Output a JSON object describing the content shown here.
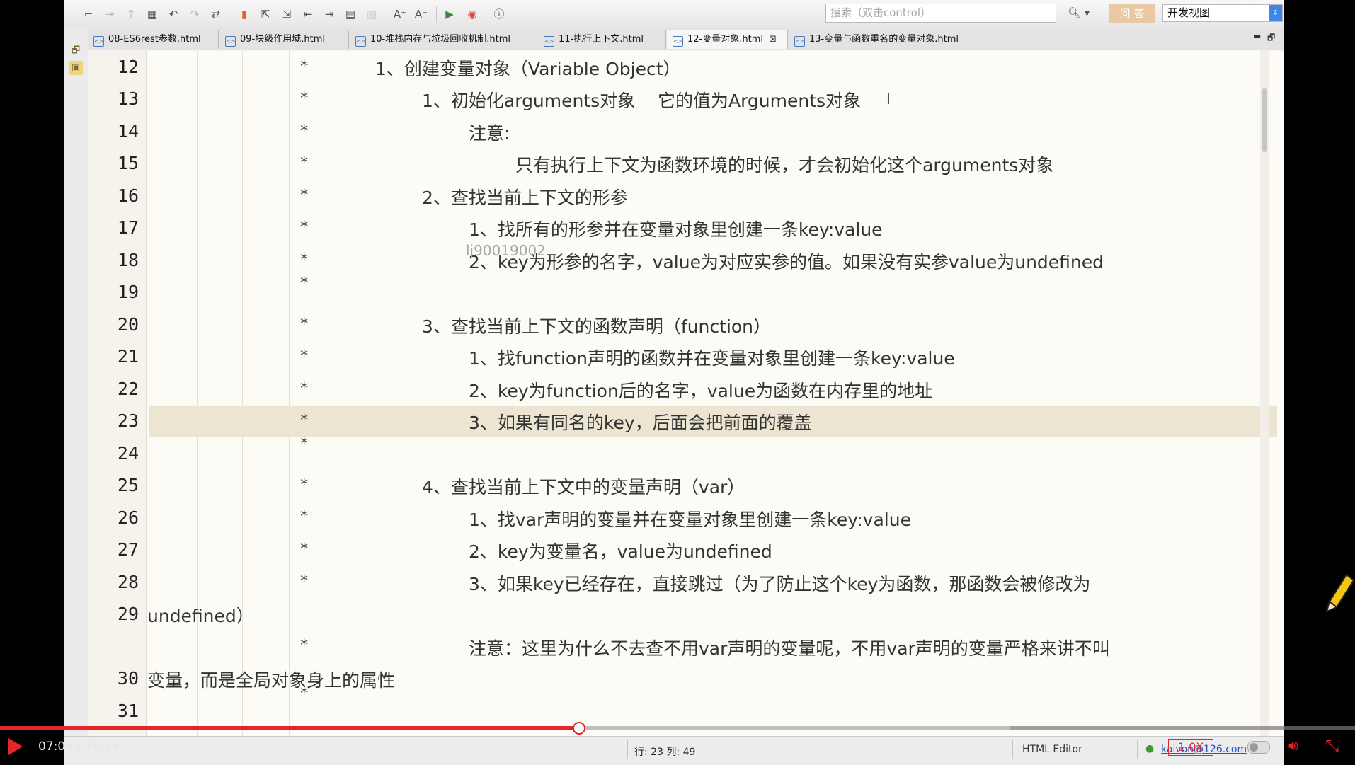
{
  "toolbar": {
    "search_placeholder": "搜索（双击control）",
    "ask_label": "问 答",
    "view_label": "开发视图"
  },
  "tabs": [
    {
      "label": "08-ES6rest参数.html"
    },
    {
      "label": "09-块级作用域.html"
    },
    {
      "label": "10-堆栈内存与垃圾回收机制.html"
    },
    {
      "label": "11-执行上下文.html"
    },
    {
      "label": "12-变量对象.html",
      "active": true
    },
    {
      "label": "13-变量与函数重名的变量对象.html"
    }
  ],
  "editor": {
    "line_numbers": [
      "12",
      "13",
      "14",
      "15",
      "16",
      "17",
      "18",
      "19",
      "20",
      "21",
      "22",
      "23",
      "24",
      "25",
      "26",
      "27",
      "28",
      "29",
      "30",
      "31"
    ],
    "lines": [
      "1、创建变量对象（Variable Object）",
      "1、初始化arguments对象    它的值为Arguments对象",
      "注意:",
      "只有执行上下文为函数环境的时候，才会初始化这个arguments对象",
      "2、查找当前上下文的形参",
      "1、找所有的形参并在变量对象里创建一条key:value",
      "2、key为形参的名字，value为对应实参的值。如果没有实参value为undefined",
      "3、查找当前上下文的函数声明（function）",
      "1、找function声明的函数并在变量对象里创建一条key:value",
      "2、key为function后的名字，value为函数在内存里的地址",
      "3、如果有同名的key，后面会把前面的覆盖",
      "4、查找当前上下文中的变量声明（var）",
      "1、找var声明的变量并在变量对象里创建一条key:value",
      "2、key为变量名，value为undefined",
      "3、如果key已经存在，直接跳过（为了防止这个key为函数，那函数会被修改为",
      "undefined）",
      "注意：这里为什么不去查不用var声明的变量呢，不用var声明的变量严格来讲不叫",
      "变量，而是全局对象身上的属性"
    ],
    "star": "*",
    "watermark": "lj90019002",
    "cursor_char": "I"
  },
  "status": {
    "position": "行: 23 列: 49",
    "mode": "HTML Editor",
    "user": "kaivon@126.com"
  },
  "player": {
    "time": "07:09 / 16:38",
    "speed": "1.0X",
    "progress": 0.427,
    "buffered": 0.745,
    "accent": "#e3262b"
  }
}
